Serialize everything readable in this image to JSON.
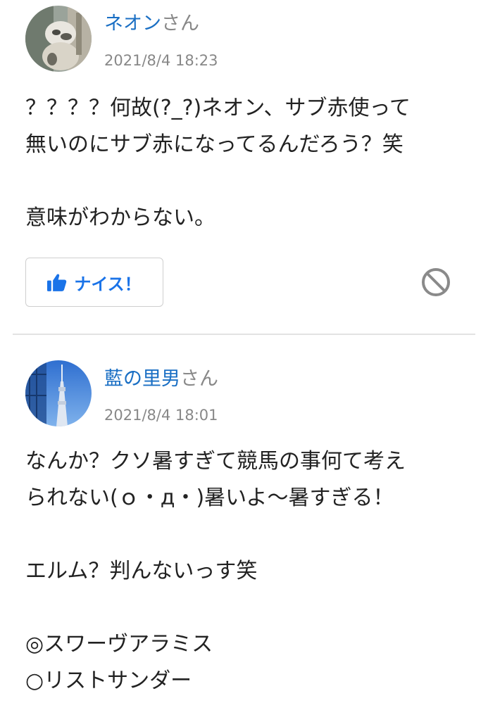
{
  "comments": [
    {
      "username": "ネオン",
      "honorific": "さん",
      "date": "2021/8/4 18:23",
      "lines": [
        "？？？？何故(?_?)ネオン、サブ赤使って",
        "無いのにサブ赤になってるんだろう？笑",
        "",
        "意味がわからない。"
      ],
      "nice_label": "ナイス！",
      "avatar_icon": "cat-photo-avatar",
      "block_icon": "block-icon"
    },
    {
      "username": "藍の里男",
      "honorific": "さん",
      "date": "2021/8/4 18:01",
      "lines": [
        "なんか？クソ暑すぎて競馬の事何て考え",
        "られない(ｏ・д・)暑いよ〜暑すぎる！",
        "",
        "エルム？判んないっす笑",
        "",
        "◎スワーヴアラミス",
        "○リストサンダー"
      ],
      "avatar_icon": "tower-photo-avatar"
    }
  ],
  "colors": {
    "username": "#1a6fc4",
    "meta": "#888888",
    "nice": "#1a73e8",
    "divider": "#e3e3e3"
  }
}
